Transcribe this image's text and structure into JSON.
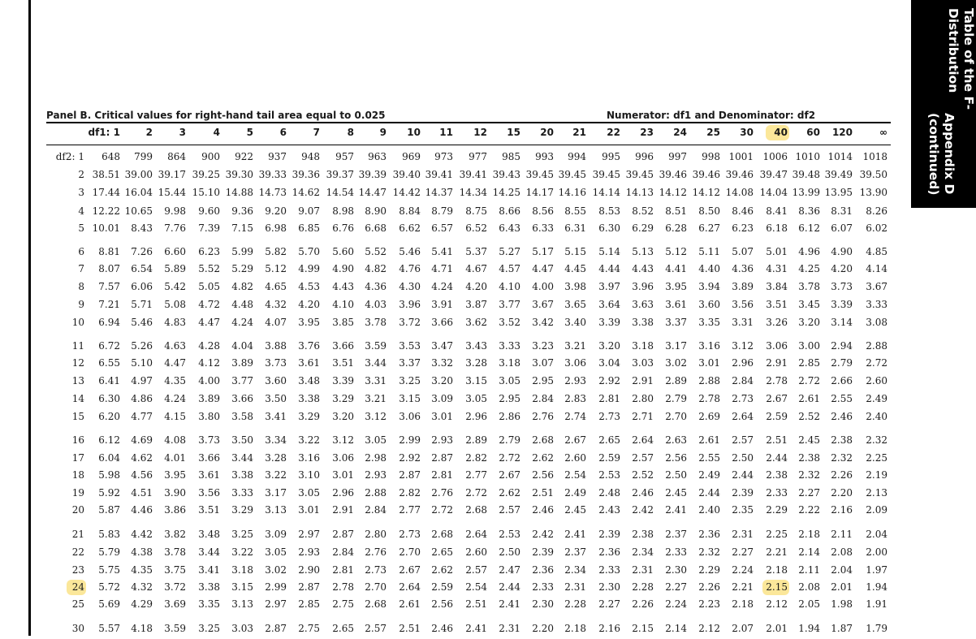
{
  "sidebar": {
    "line1": "Appendix D (continued)",
    "line2": "Table of the F-Distribution"
  },
  "panel_title": "Panel B. Critical values for right-hand tail area equal to 0.025",
  "numerator_label": "Numerator: df1 and Denominator: df2",
  "header": {
    "df1_label": "df1: 1",
    "columns": [
      "2",
      "3",
      "4",
      "5",
      "6",
      "7",
      "8",
      "9",
      "10",
      "11",
      "12",
      "15",
      "20",
      "21",
      "22",
      "23",
      "24",
      "25",
      "30",
      "40",
      "60",
      "120",
      "∞"
    ]
  },
  "rows": [
    {
      "df2": "df2: 1",
      "values": [
        "648",
        "799",
        "864",
        "900",
        "922",
        "937",
        "948",
        "957",
        "963",
        "969",
        "973",
        "977",
        "985",
        "993",
        "994",
        "995",
        "996",
        "997",
        "998",
        "1001",
        "1006",
        "1010",
        "1014",
        "1018"
      ]
    },
    {
      "df2": "2",
      "values": [
        "38.51",
        "39.00",
        "39.17",
        "39.25",
        "39.30",
        "39.33",
        "39.36",
        "39.37",
        "39.39",
        "39.40",
        "39.41",
        "39.41",
        "39.43",
        "39.45",
        "39.45",
        "39.45",
        "39.45",
        "39.46",
        "39.46",
        "39.46",
        "39.47",
        "39.48",
        "39.49",
        "39.50"
      ]
    },
    {
      "df2": "3",
      "values": [
        "17.44",
        "16.04",
        "15.44",
        "15.10",
        "14.88",
        "14.73",
        "14.62",
        "14.54",
        "14.47",
        "14.42",
        "14.37",
        "14.34",
        "14.25",
        "14.17",
        "14.16",
        "14.14",
        "14.13",
        "14.12",
        "14.12",
        "14.08",
        "14.04",
        "13.99",
        "13.95",
        "13.90"
      ]
    },
    {
      "df2": "4",
      "values": [
        "12.22",
        "10.65",
        "9.98",
        "9.60",
        "9.36",
        "9.20",
        "9.07",
        "8.98",
        "8.90",
        "8.84",
        "8.79",
        "8.75",
        "8.66",
        "8.56",
        "8.55",
        "8.53",
        "8.52",
        "8.51",
        "8.50",
        "8.46",
        "8.41",
        "8.36",
        "8.31",
        "8.26"
      ]
    },
    {
      "df2": "5",
      "values": [
        "10.01",
        "8.43",
        "7.76",
        "7.39",
        "7.15",
        "6.98",
        "6.85",
        "6.76",
        "6.68",
        "6.62",
        "6.57",
        "6.52",
        "6.43",
        "6.33",
        "6.31",
        "6.30",
        "6.29",
        "6.28",
        "6.27",
        "6.23",
        "6.18",
        "6.12",
        "6.07",
        "6.02"
      ]
    },
    {
      "df2": "6",
      "values": [
        "8.81",
        "7.26",
        "6.60",
        "6.23",
        "5.99",
        "5.82",
        "5.70",
        "5.60",
        "5.52",
        "5.46",
        "5.41",
        "5.37",
        "5.27",
        "5.17",
        "5.15",
        "5.14",
        "5.13",
        "5.12",
        "5.11",
        "5.07",
        "5.01",
        "4.96",
        "4.90",
        "4.85"
      ]
    },
    {
      "df2": "7",
      "values": [
        "8.07",
        "6.54",
        "5.89",
        "5.52",
        "5.29",
        "5.12",
        "4.99",
        "4.90",
        "4.82",
        "4.76",
        "4.71",
        "4.67",
        "4.57",
        "4.47",
        "4.45",
        "4.44",
        "4.43",
        "4.41",
        "4.40",
        "4.36",
        "4.31",
        "4.25",
        "4.20",
        "4.14"
      ]
    },
    {
      "df2": "8",
      "values": [
        "7.57",
        "6.06",
        "5.42",
        "5.05",
        "4.82",
        "4.65",
        "4.53",
        "4.43",
        "4.36",
        "4.30",
        "4.24",
        "4.20",
        "4.10",
        "4.00",
        "3.98",
        "3.97",
        "3.96",
        "3.95",
        "3.94",
        "3.89",
        "3.84",
        "3.78",
        "3.73",
        "3.67"
      ]
    },
    {
      "df2": "9",
      "values": [
        "7.21",
        "5.71",
        "5.08",
        "4.72",
        "4.48",
        "4.32",
        "4.20",
        "4.10",
        "4.03",
        "3.96",
        "3.91",
        "3.87",
        "3.77",
        "3.67",
        "3.65",
        "3.64",
        "3.63",
        "3.61",
        "3.60",
        "3.56",
        "3.51",
        "3.45",
        "3.39",
        "3.33"
      ]
    },
    {
      "df2": "10",
      "values": [
        "6.94",
        "5.46",
        "4.83",
        "4.47",
        "4.24",
        "4.07",
        "3.95",
        "3.85",
        "3.78",
        "3.72",
        "3.66",
        "3.62",
        "3.52",
        "3.42",
        "3.40",
        "3.39",
        "3.38",
        "3.37",
        "3.35",
        "3.31",
        "3.26",
        "3.20",
        "3.14",
        "3.08"
      ]
    },
    {
      "df2": "11",
      "values": [
        "6.72",
        "5.26",
        "4.63",
        "4.28",
        "4.04",
        "3.88",
        "3.76",
        "3.66",
        "3.59",
        "3.53",
        "3.47",
        "3.43",
        "3.33",
        "3.23",
        "3.21",
        "3.20",
        "3.18",
        "3.17",
        "3.16",
        "3.12",
        "3.06",
        "3.00",
        "2.94",
        "2.88"
      ]
    },
    {
      "df2": "12",
      "values": [
        "6.55",
        "5.10",
        "4.47",
        "4.12",
        "3.89",
        "3.73",
        "3.61",
        "3.51",
        "3.44",
        "3.37",
        "3.32",
        "3.28",
        "3.18",
        "3.07",
        "3.06",
        "3.04",
        "3.03",
        "3.02",
        "3.01",
        "2.96",
        "2.91",
        "2.85",
        "2.79",
        "2.72"
      ]
    },
    {
      "df2": "13",
      "values": [
        "6.41",
        "4.97",
        "4.35",
        "4.00",
        "3.77",
        "3.60",
        "3.48",
        "3.39",
        "3.31",
        "3.25",
        "3.20",
        "3.15",
        "3.05",
        "2.95",
        "2.93",
        "2.92",
        "2.91",
        "2.89",
        "2.88",
        "2.84",
        "2.78",
        "2.72",
        "2.66",
        "2.60"
      ]
    },
    {
      "df2": "14",
      "values": [
        "6.30",
        "4.86",
        "4.24",
        "3.89",
        "3.66",
        "3.50",
        "3.38",
        "3.29",
        "3.21",
        "3.15",
        "3.09",
        "3.05",
        "2.95",
        "2.84",
        "2.83",
        "2.81",
        "2.80",
        "2.79",
        "2.78",
        "2.73",
        "2.67",
        "2.61",
        "2.55",
        "2.49"
      ]
    },
    {
      "df2": "15",
      "values": [
        "6.20",
        "4.77",
        "4.15",
        "3.80",
        "3.58",
        "3.41",
        "3.29",
        "3.20",
        "3.12",
        "3.06",
        "3.01",
        "2.96",
        "2.86",
        "2.76",
        "2.74",
        "2.73",
        "2.71",
        "2.70",
        "2.69",
        "2.64",
        "2.59",
        "2.52",
        "2.46",
        "2.40"
      ]
    },
    {
      "df2": "16",
      "values": [
        "6.12",
        "4.69",
        "4.08",
        "3.73",
        "3.50",
        "3.34",
        "3.22",
        "3.12",
        "3.05",
        "2.99",
        "2.93",
        "2.89",
        "2.79",
        "2.68",
        "2.67",
        "2.65",
        "2.64",
        "2.63",
        "2.61",
        "2.57",
        "2.51",
        "2.45",
        "2.38",
        "2.32"
      ]
    },
    {
      "df2": "17",
      "values": [
        "6.04",
        "4.62",
        "4.01",
        "3.66",
        "3.44",
        "3.28",
        "3.16",
        "3.06",
        "2.98",
        "2.92",
        "2.87",
        "2.82",
        "2.72",
        "2.62",
        "2.60",
        "2.59",
        "2.57",
        "2.56",
        "2.55",
        "2.50",
        "2.44",
        "2.38",
        "2.32",
        "2.25"
      ]
    },
    {
      "df2": "18",
      "values": [
        "5.98",
        "4.56",
        "3.95",
        "3.61",
        "3.38",
        "3.22",
        "3.10",
        "3.01",
        "2.93",
        "2.87",
        "2.81",
        "2.77",
        "2.67",
        "2.56",
        "2.54",
        "2.53",
        "2.52",
        "2.50",
        "2.49",
        "2.44",
        "2.38",
        "2.32",
        "2.26",
        "2.19"
      ]
    },
    {
      "df2": "19",
      "values": [
        "5.92",
        "4.51",
        "3.90",
        "3.56",
        "3.33",
        "3.17",
        "3.05",
        "2.96",
        "2.88",
        "2.82",
        "2.76",
        "2.72",
        "2.62",
        "2.51",
        "2.49",
        "2.48",
        "2.46",
        "2.45",
        "2.44",
        "2.39",
        "2.33",
        "2.27",
        "2.20",
        "2.13"
      ]
    },
    {
      "df2": "20",
      "values": [
        "5.87",
        "4.46",
        "3.86",
        "3.51",
        "3.29",
        "3.13",
        "3.01",
        "2.91",
        "2.84",
        "2.77",
        "2.72",
        "2.68",
        "2.57",
        "2.46",
        "2.45",
        "2.43",
        "2.42",
        "2.41",
        "2.40",
        "2.35",
        "2.29",
        "2.22",
        "2.16",
        "2.09"
      ]
    },
    {
      "df2": "21",
      "values": [
        "5.83",
        "4.42",
        "3.82",
        "3.48",
        "3.25",
        "3.09",
        "2.97",
        "2.87",
        "2.80",
        "2.73",
        "2.68",
        "2.64",
        "2.53",
        "2.42",
        "2.41",
        "2.39",
        "2.38",
        "2.37",
        "2.36",
        "2.31",
        "2.25",
        "2.18",
        "2.11",
        "2.04"
      ]
    },
    {
      "df2": "22",
      "values": [
        "5.79",
        "4.38",
        "3.78",
        "3.44",
        "3.22",
        "3.05",
        "2.93",
        "2.84",
        "2.76",
        "2.70",
        "2.65",
        "2.60",
        "2.50",
        "2.39",
        "2.37",
        "2.36",
        "2.34",
        "2.33",
        "2.32",
        "2.27",
        "2.21",
        "2.14",
        "2.08",
        "2.00"
      ]
    },
    {
      "df2": "23",
      "values": [
        "5.75",
        "4.35",
        "3.75",
        "3.41",
        "3.18",
        "3.02",
        "2.90",
        "2.81",
        "2.73",
        "2.67",
        "2.62",
        "2.57",
        "2.47",
        "2.36",
        "2.34",
        "2.33",
        "2.31",
        "2.30",
        "2.29",
        "2.24",
        "2.18",
        "2.11",
        "2.04",
        "1.97"
      ]
    },
    {
      "df2": "24",
      "values": [
        "5.72",
        "4.32",
        "3.72",
        "3.38",
        "3.15",
        "2.99",
        "2.87",
        "2.78",
        "2.70",
        "2.64",
        "2.59",
        "2.54",
        "2.44",
        "2.33",
        "2.31",
        "2.30",
        "2.28",
        "2.27",
        "2.26",
        "2.21",
        "2.15",
        "2.08",
        "2.01",
        "1.94"
      ]
    },
    {
      "df2": "25",
      "values": [
        "5.69",
        "4.29",
        "3.69",
        "3.35",
        "3.13",
        "2.97",
        "2.85",
        "2.75",
        "2.68",
        "2.61",
        "2.56",
        "2.51",
        "2.41",
        "2.30",
        "2.28",
        "2.27",
        "2.26",
        "2.24",
        "2.23",
        "2.18",
        "2.12",
        "2.05",
        "1.98",
        "1.91"
      ]
    },
    {
      "df2": "30",
      "values": [
        "5.57",
        "4.18",
        "3.59",
        "3.25",
        "3.03",
        "2.87",
        "2.75",
        "2.65",
        "2.57",
        "2.51",
        "2.46",
        "2.41",
        "2.31",
        "2.20",
        "2.18",
        "2.16",
        "2.15",
        "2.14",
        "2.12",
        "2.07",
        "2.01",
        "1.94",
        "1.87",
        "1.79"
      ]
    }
  ],
  "highlight": {
    "column": "40",
    "row": "24",
    "value": "2.15",
    "color": "#fbe79a"
  }
}
